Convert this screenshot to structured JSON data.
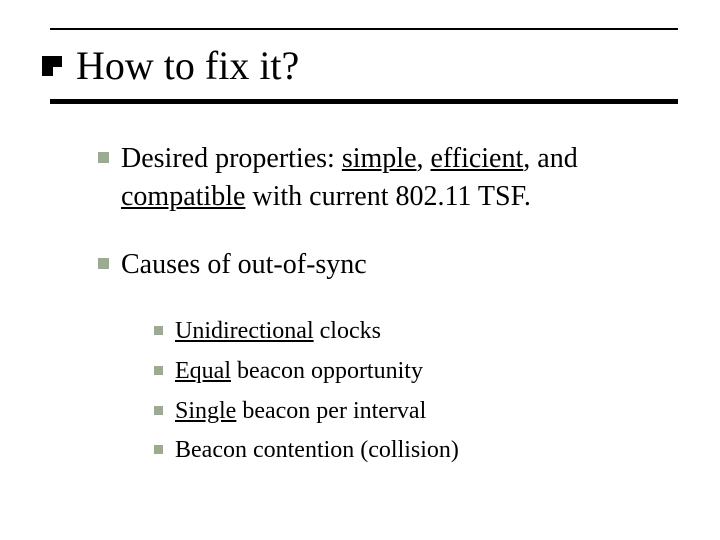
{
  "title": "How to fix it?",
  "l1": [
    {
      "pre": "Desired properties: ",
      "u1": "simple",
      "mid1": ", ",
      "u2": "efficient",
      "mid2": ", and ",
      "u3": "compatible",
      "post": " with current 802.11 TSF."
    },
    {
      "plain": "Causes of out-of-sync"
    }
  ],
  "l2": [
    {
      "u": "Unidirectional",
      "rest": " clocks"
    },
    {
      "u": "Equal",
      "rest": " beacon opportunity"
    },
    {
      "u": "Single",
      "rest": " beacon per interval"
    },
    {
      "u": "",
      "rest": "Beacon contention (collision)"
    }
  ]
}
